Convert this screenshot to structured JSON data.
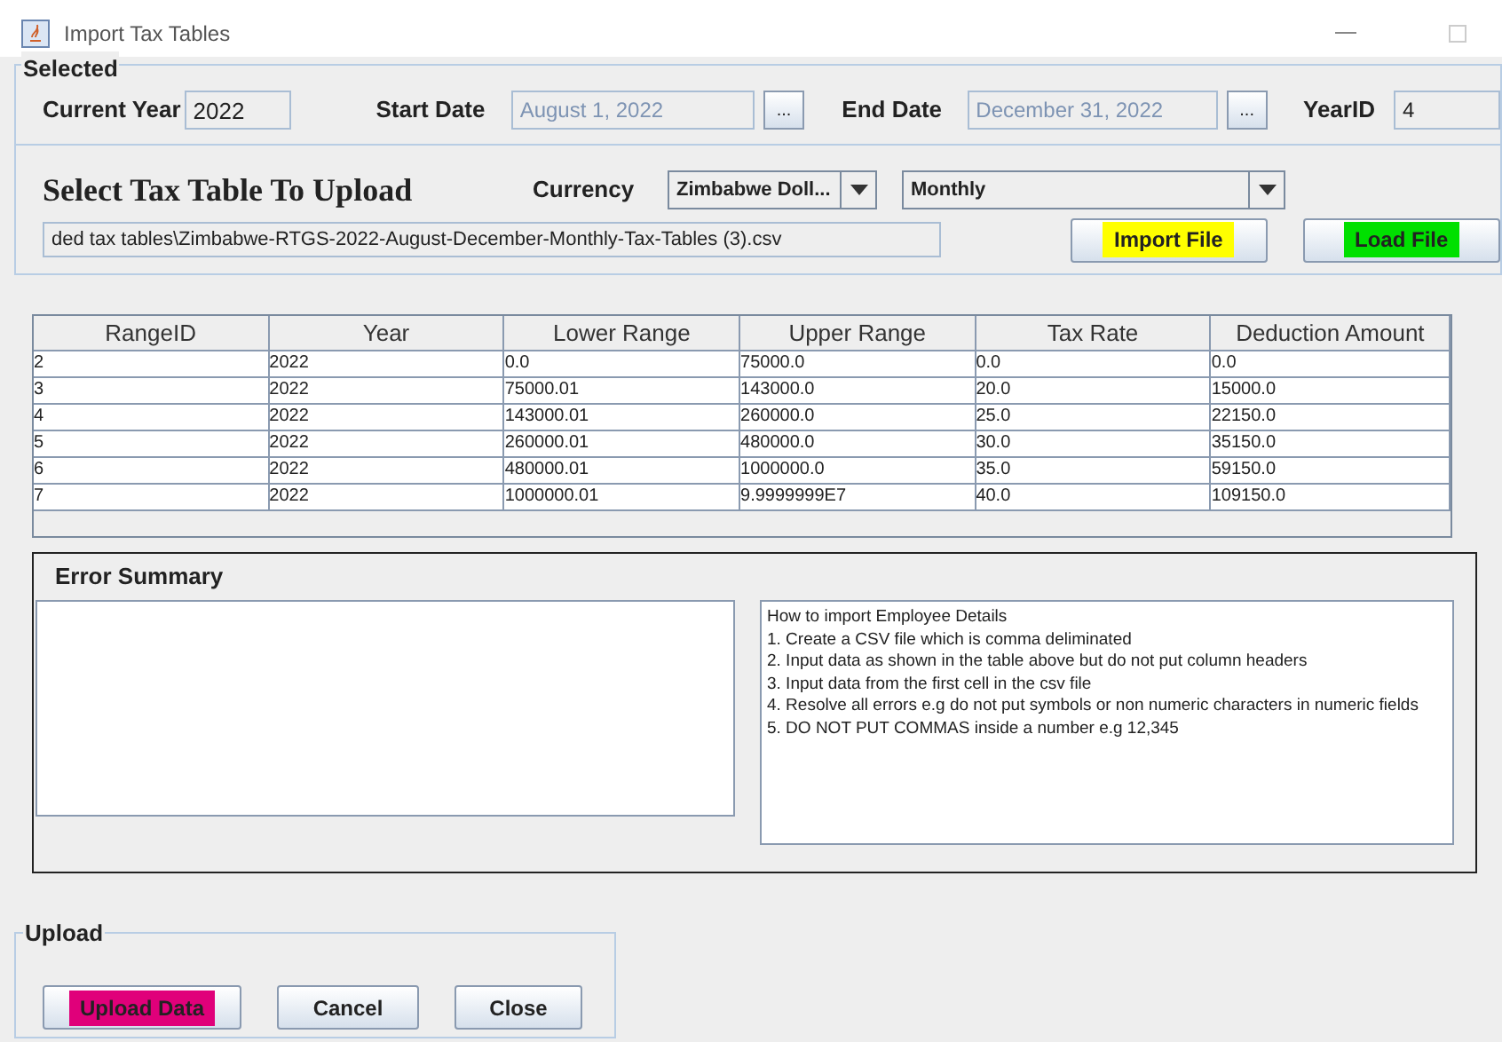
{
  "window": {
    "title": "Import Tax Tables"
  },
  "selected_group": {
    "legend": "Selected",
    "current_year_label": "Current Year",
    "current_year": "2022",
    "start_date_label": "Start Date",
    "start_date": "August 1, 2022",
    "start_picker": "...",
    "end_date_label": "End Date",
    "end_date": "December 31, 2022",
    "end_picker": "...",
    "year_id_label": "YearID",
    "year_id": "4"
  },
  "upload_section": {
    "heading": "Select Tax Table To Upload",
    "currency_label": "Currency",
    "currency": "Zimbabwe Doll...",
    "period": "Monthly",
    "file_path": "ded tax tables\\Zimbabwe-RTGS-2022-August-December-Monthly-Tax-Tables (3).csv",
    "buttons": [
      {
        "label": "Import File",
        "color": "#ffff00"
      },
      {
        "label": "Load File",
        "color": "#00e000"
      }
    ]
  },
  "table": {
    "columns": [
      "RangeID",
      "Year",
      "Lower Range",
      "Upper Range",
      "Tax Rate",
      "Deduction Amount"
    ],
    "rows": [
      [
        "2",
        "2022",
        "0.0",
        "75000.0",
        "0.0",
        "0.0"
      ],
      [
        "3",
        "2022",
        "75000.01",
        "143000.0",
        "20.0",
        "15000.0"
      ],
      [
        "4",
        "2022",
        "143000.01",
        "260000.0",
        "25.0",
        "22150.0"
      ],
      [
        "5",
        "2022",
        "260000.01",
        "480000.0",
        "30.0",
        "35150.0"
      ],
      [
        "6",
        "2022",
        "480000.01",
        "1000000.0",
        "35.0",
        "59150.0"
      ],
      [
        "7",
        "2022",
        "1000000.01",
        "9.9999999E7",
        "40.0",
        "109150.0"
      ]
    ]
  },
  "error_summary": {
    "title": "Error Summary",
    "instructions": [
      "How to import Employee Details",
      "1. Create a CSV file which is comma deliminated",
      "2. Input data as shown in the table above but do not put column headers",
      "3. Input data from the first cell in the csv file",
      "4. Resolve all errors e.g do not put symbols or non numeric characters in numeric fields",
      "5. DO NOT PUT COMMAS inside a number e.g 12,345"
    ]
  },
  "upload_group": {
    "legend": "Upload",
    "buttons": [
      {
        "label": "Upload Data",
        "color": "#e0007a"
      },
      {
        "label": "Cancel"
      },
      {
        "label": "Close"
      }
    ]
  }
}
